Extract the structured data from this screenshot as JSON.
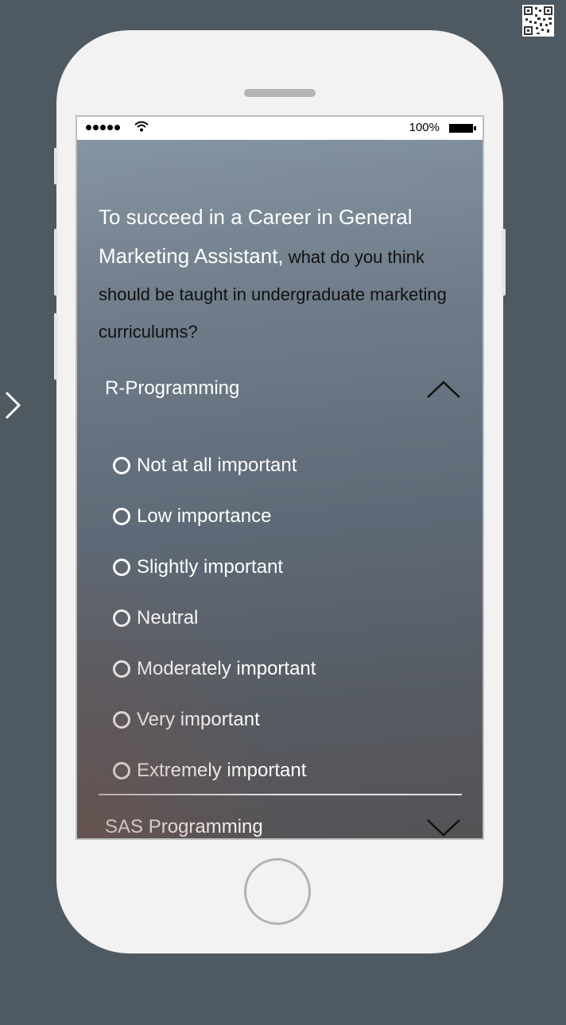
{
  "status_bar": {
    "battery_percent": "100%"
  },
  "question": {
    "main": "To succeed in a Career in General Marketing Assistant,",
    "rest": " what do you think should be taught in undergraduate marketing curriculums?"
  },
  "accordion": [
    {
      "title": "R-Programming",
      "expanded": true,
      "options": [
        "Not at all important",
        "Low importance",
        "Slightly important",
        "Neutral",
        "Moderately important",
        "Very important",
        "Extremely important"
      ]
    },
    {
      "title": "SAS Programming",
      "expanded": false
    }
  ],
  "icons": {
    "qr": "qr-code-icon",
    "nav": "chevron-right-icon",
    "expanded": "chevron-up-icon",
    "collapsed": "chevron-down-icon"
  }
}
